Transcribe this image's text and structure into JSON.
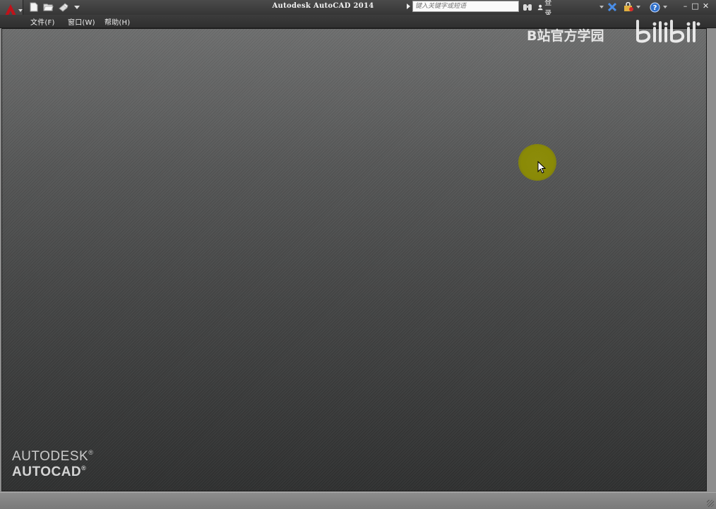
{
  "window": {
    "title": "Autodesk AutoCAD 2014",
    "controls": {
      "minimize": "–",
      "maximize": "□",
      "close": "✕"
    }
  },
  "quick_access": {
    "icons": [
      "new-file-icon",
      "open-folder-icon",
      "plot-icon",
      "dropdown-arrow-icon"
    ]
  },
  "search": {
    "placeholder": "键入关键字或短语"
  },
  "infocenter": {
    "login_label": "登录",
    "icons": [
      "binoculars-icon",
      "user-icon",
      "exchange-x-icon",
      "autodesk-store-icon",
      "help-icon"
    ]
  },
  "menu": {
    "items": [
      {
        "label": "文件(F)"
      },
      {
        "label": "窗口(W)"
      },
      {
        "label": "帮助(H)"
      }
    ]
  },
  "watermark": {
    "text": "B站官方学园",
    "logo": "bilibili"
  },
  "branding": {
    "line1": "AUTODESK",
    "line2": "AUTOCAD",
    "reg": "®"
  },
  "colors": {
    "brand_red": "#c0121a",
    "cursor_highlight": "#8c8c0b"
  }
}
